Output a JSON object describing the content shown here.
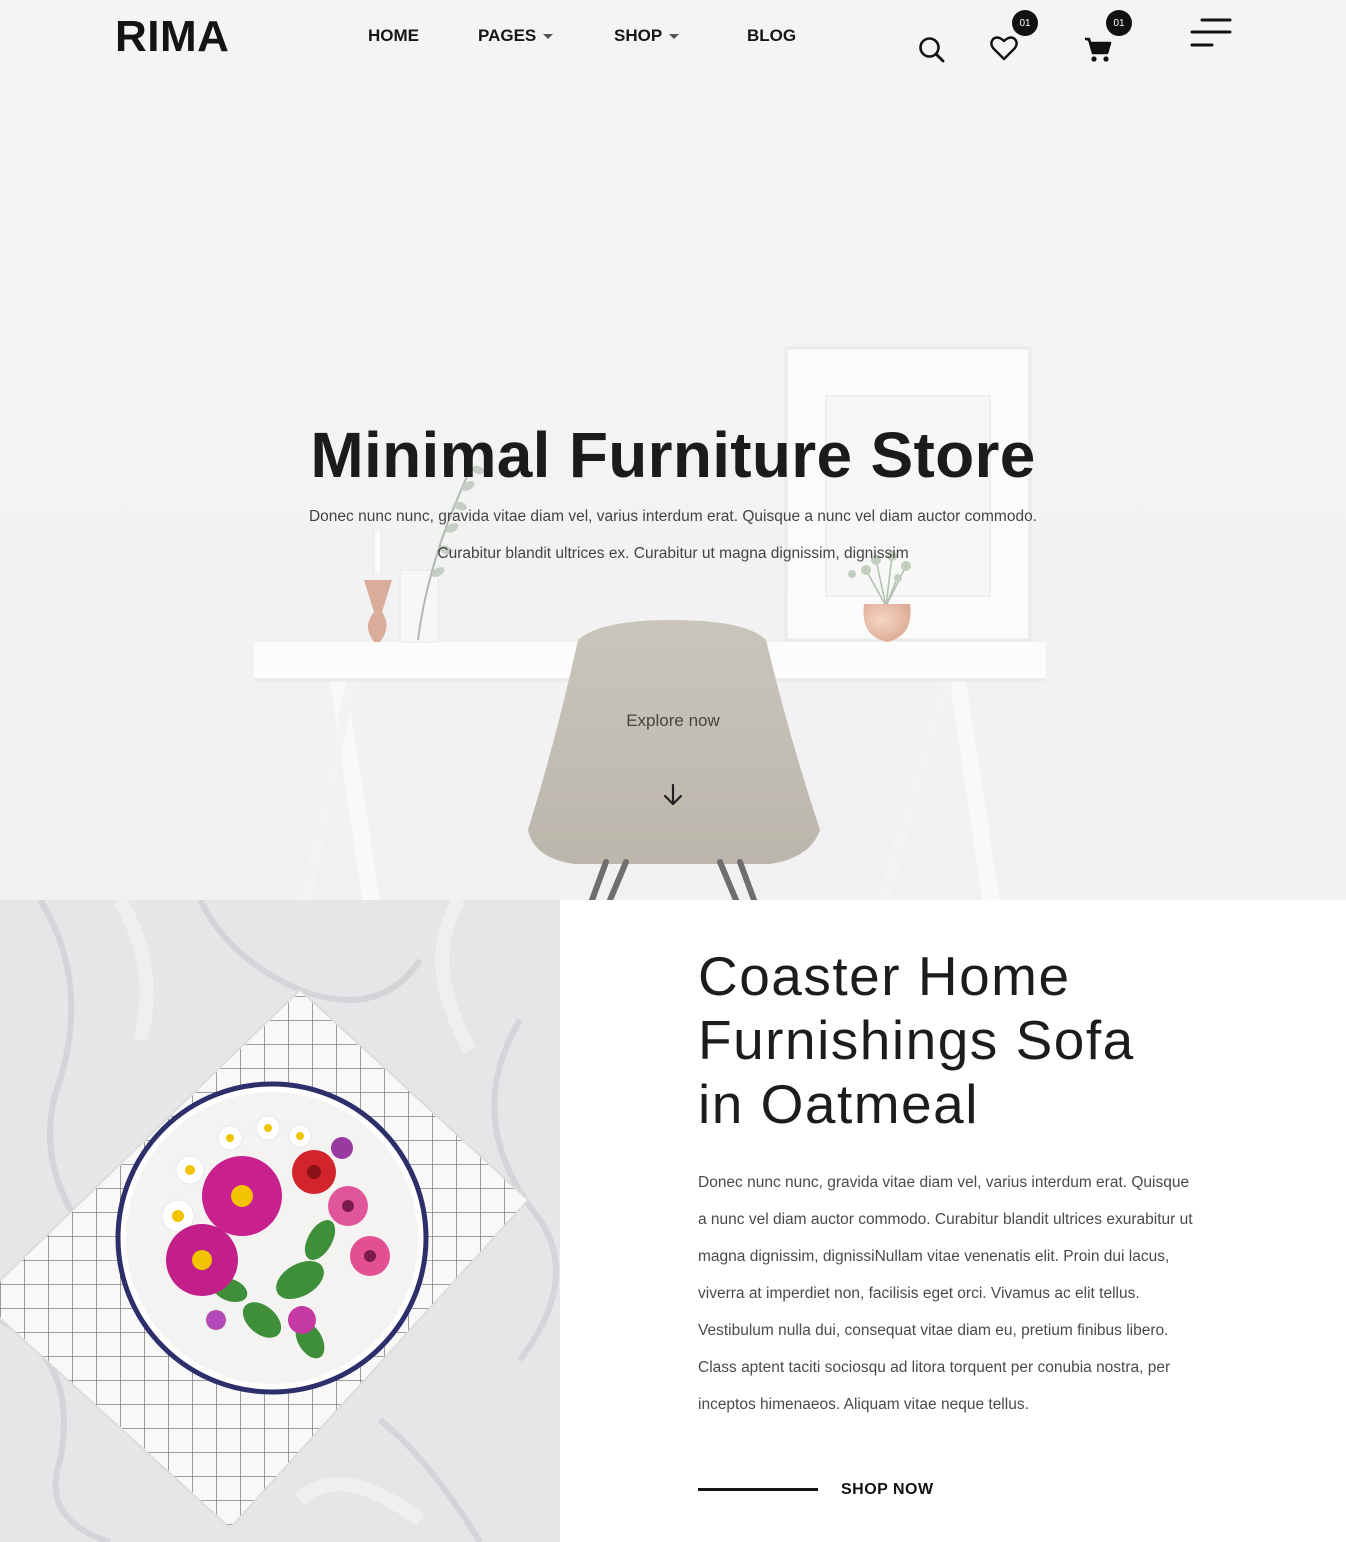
{
  "header": {
    "logo": "RIMA",
    "nav": [
      {
        "label": "HOME",
        "has_dropdown": false
      },
      {
        "label": "PAGES",
        "has_dropdown": true
      },
      {
        "label": "SHOP",
        "has_dropdown": true
      },
      {
        "label": "BLOG",
        "has_dropdown": false
      }
    ],
    "icons": [
      "search-icon",
      "heart-icon",
      "cart-icon",
      "menu-icon"
    ],
    "wishlist_count": "01",
    "cart_count": "01"
  },
  "hero": {
    "title": "Minimal Furniture Store",
    "subtitle_line1": "Donec nunc nunc, gravida vitae diam vel, varius interdum erat. Quisque a nunc vel diam auctor commodo.",
    "subtitle_line2": "Curabitur blandit ultrices ex. Curabitur ut magna dignissim, dignissim",
    "cta": "Explore now"
  },
  "feature": {
    "title_lines": [
      "Coaster Home",
      "Furnishings Sofa",
      "in Oatmeal"
    ],
    "body_lines": [
      "Donec nunc nunc, gravida vitae diam vel, varius interdum erat. Quisque",
      "a nunc vel diam auctor commodo. Curabitur blandit ultrices exurabitur ut",
      "magna dignissim, dignissiNullam vitae venenatis elit. Proin dui lacus,",
      "viverra at imperdiet non, facilisis eget orci. Vivamus ac elit tellus.",
      "Vestibulum nulla dui, consequat vitae diam eu, pretium finibus libero.",
      "Class aptent taciti sociosqu ad litora torquent per conubia nostra, per",
      "inceptos himenaeos. Aliquam vitae neque tellus."
    ],
    "cta": "SHOP NOW"
  },
  "colors": {
    "text_dark": "#1a1a1a",
    "badge": "#111111",
    "chair": "#aaa393",
    "copper": "#c9876a"
  }
}
